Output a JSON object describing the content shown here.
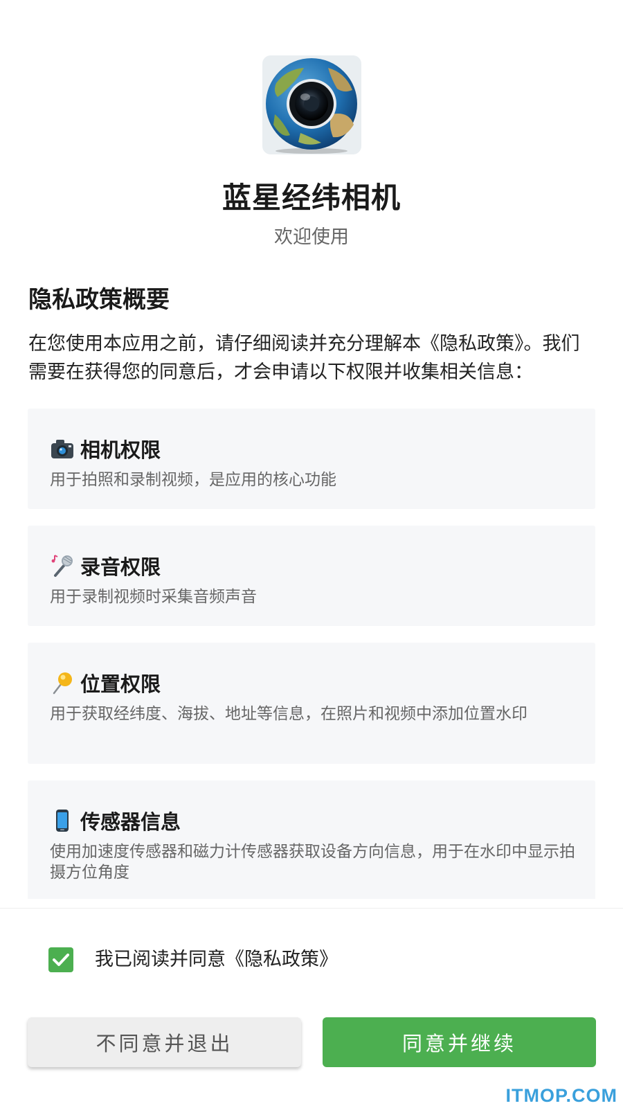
{
  "app": {
    "name": "蓝星经纬相机",
    "welcome": "欢迎使用",
    "logo_icon": "globe-camera-lens-icon"
  },
  "privacy": {
    "title": "隐私政策概要",
    "intro": "在您使用本应用之前，请仔细阅读并充分理解本《隐私政策》。我们需要在获得您的同意后，才会申请以下权限并收集相关信息："
  },
  "permissions": [
    {
      "icon": "camera-icon",
      "title": "相机权限",
      "desc": "用于拍照和录制视频，是应用的核心功能"
    },
    {
      "icon": "microphone-icon",
      "title": "录音权限",
      "desc": "用于录制视频时采集音频声音"
    },
    {
      "icon": "location-pin-icon",
      "title": "位置权限",
      "desc": "用于获取经纬度、海拔、地址等信息，在照片和视频中添加位置水印"
    },
    {
      "icon": "phone-icon",
      "title": "传感器信息",
      "desc": "使用加速度传感器和磁力计传感器获取设备方向信息，用于在水印中显示拍摄方位角度"
    }
  ],
  "consent": {
    "checked": true,
    "label": "我已阅读并同意《隐私政策》"
  },
  "buttons": {
    "disagree": "不同意并退出",
    "agree": "同意并继续"
  },
  "watermark": "ITMOP.COM",
  "colors": {
    "accent": "#4caf50",
    "card_bg": "#f6f7f9",
    "watermark": "#3aa0dc"
  }
}
